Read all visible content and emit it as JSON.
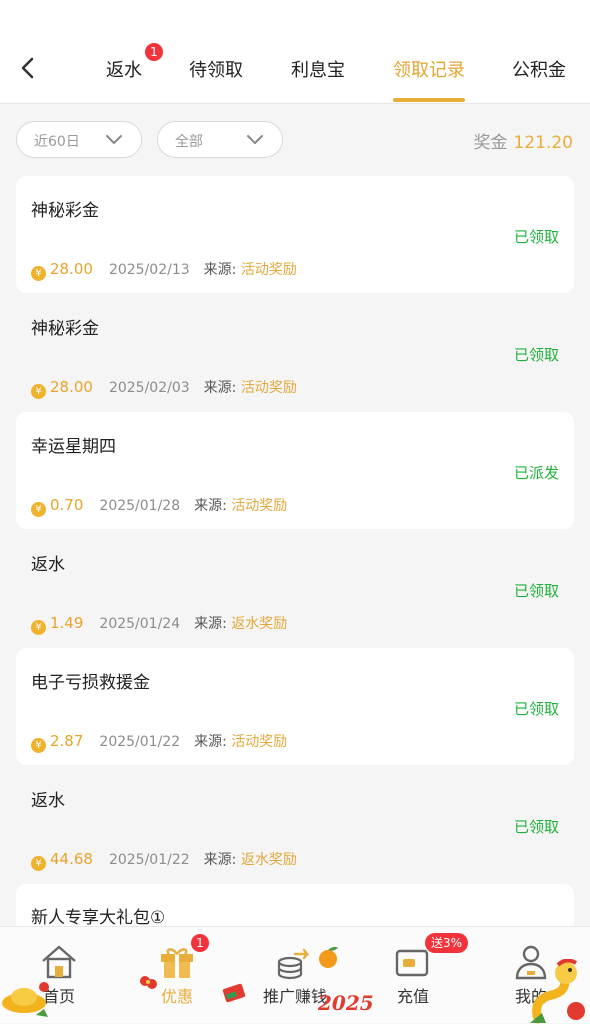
{
  "tabs": [
    {
      "label": "返水",
      "badge": "1",
      "active": false
    },
    {
      "label": "待领取",
      "active": false
    },
    {
      "label": "利息宝",
      "active": false
    },
    {
      "label": "领取记录",
      "active": true
    },
    {
      "label": "公积金",
      "active": false
    }
  ],
  "filters": {
    "period": "近60日",
    "type": "全部"
  },
  "bonus": {
    "label": "奖金",
    "amount": "121.20"
  },
  "source_label": "来源:",
  "records": [
    {
      "title": "神秘彩金",
      "status": "已领取",
      "amount": "28.00",
      "date": "2025/02/13",
      "source": "活动奖励"
    },
    {
      "title": "神秘彩金",
      "status": "已领取",
      "amount": "28.00",
      "date": "2025/02/03",
      "source": "活动奖励"
    },
    {
      "title": "幸运星期四",
      "status": "已派发",
      "amount": "0.70",
      "date": "2025/01/28",
      "source": "活动奖励"
    },
    {
      "title": "返水",
      "status": "已领取",
      "amount": "1.49",
      "date": "2025/01/24",
      "source": "返水奖励"
    },
    {
      "title": "电子亏损救援金",
      "status": "已领取",
      "amount": "2.87",
      "date": "2025/01/22",
      "source": "活动奖励"
    },
    {
      "title": "返水",
      "status": "已领取",
      "amount": "44.68",
      "date": "2025/01/22",
      "source": "返水奖励"
    }
  ],
  "partial_record": {
    "title": "新人专享大礼包①"
  },
  "nav": [
    {
      "label": "首页",
      "icon": "home-icon",
      "active": false
    },
    {
      "label": "优惠",
      "icon": "gift-icon",
      "active": true,
      "badge": "1"
    },
    {
      "label": "推广赚钱",
      "icon": "coins-share-icon",
      "active": false
    },
    {
      "label": "充值",
      "icon": "wallet-icon",
      "active": false,
      "promo": "送3%"
    },
    {
      "label": "我的",
      "icon": "user-icon",
      "active": false
    }
  ],
  "decoration_text": "2025",
  "colors": {
    "accent": "#e9ad3a",
    "status_green": "#21b13b",
    "badge_red": "#f2333c"
  }
}
